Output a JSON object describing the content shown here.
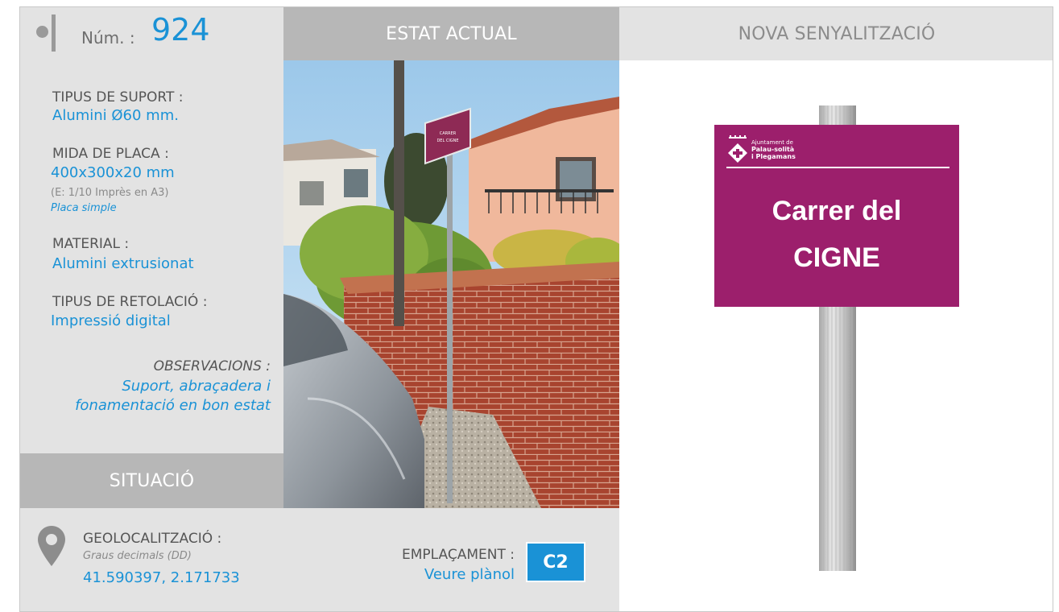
{
  "header": {
    "num_label": "Núm. :",
    "num_value": "924",
    "estat_title": "ESTAT ACTUAL",
    "nova_title": "NOVA SENYALITZACIÓ"
  },
  "info": {
    "suport_label": "TIPUS DE SUPORT :",
    "suport_value": "Alumini Ø60 mm.",
    "mida_label": "MIDA DE PLACA :",
    "mida_value": "400x300x20 mm",
    "mida_note": "(E: 1/10 Imprès en A3)",
    "mida_type": "Placa simple",
    "material_label": "MATERIAL :",
    "material_value": "Alumini extrusionat",
    "retolacio_label": "TIPUS DE RETOLACIÓ :",
    "retolacio_value": "Impressió digital",
    "observacions_label": "OBSERVACIONS :",
    "observacions_value": "Suport, abraçadera i fonamentació en bon estat"
  },
  "situacio": {
    "title": "SITUACIÓ",
    "geo_label": "GEOLOCALITZACIÓ :",
    "geo_note": "Graus decimals (DD)",
    "geo_value": "41.590397, 2.171733",
    "emplacament_label": "EMPLAÇAMENT :",
    "emplacament_link": "Veure plànol",
    "emplacament_code": "C2"
  },
  "sign": {
    "org_line1": "Ajuntament de",
    "org_line2": "Palau-solità",
    "org_line3": "i Plegamans",
    "text_line1": "Carrer del",
    "text_line2": "CIGNE"
  },
  "photo": {
    "sign_line1": "CARRER",
    "sign_line2": "DEL CIGNE"
  },
  "colors": {
    "accent": "#1a92d6",
    "panel_light": "#e3e3e3",
    "panel_dark": "#b7b7b7",
    "sign_magenta": "#9c1f6c"
  },
  "icons": [
    "location-pin-icon",
    "bullet-icon",
    "municipal-crest-icon"
  ]
}
